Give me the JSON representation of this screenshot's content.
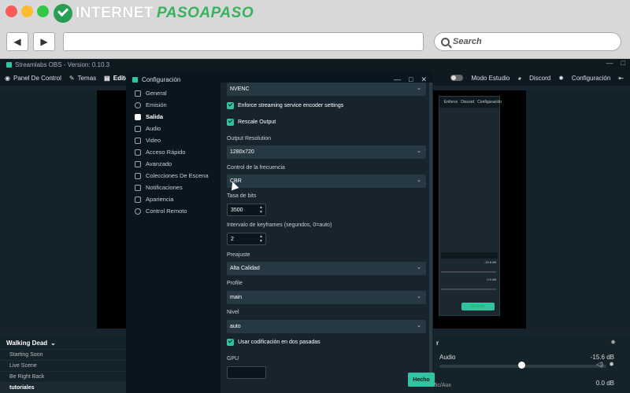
{
  "browser": {
    "brand_part1": "INTERNET",
    "brand_part2": "PASOAPASO",
    "search_placeholder": "Search",
    "back_icon": "◀",
    "forward_icon": "▶"
  },
  "app": {
    "title": "Streamlabs OBS - Version: 0.10.3",
    "nav": [
      "Panel De Control",
      "Temas",
      "Editor"
    ],
    "nav_right": [
      "Modo Estudio",
      "Discord",
      "Configuración"
    ]
  },
  "modal": {
    "title": "Configuración",
    "sidebar": [
      {
        "label": "General",
        "icon": "gear-icon"
      },
      {
        "label": "Emisión",
        "icon": "globe-icon"
      },
      {
        "label": "Salida",
        "icon": "output-icon"
      },
      {
        "label": "Audio",
        "icon": "speaker-icon"
      },
      {
        "label": "Video",
        "icon": "video-icon"
      },
      {
        "label": "Acceso Rápido",
        "icon": "shortcut-icon"
      },
      {
        "label": "Avanzado",
        "icon": "advanced-icon"
      },
      {
        "label": "Colecciones De Escena",
        "icon": "collections-icon"
      },
      {
        "label": "Notificaciones",
        "icon": "bell-icon"
      },
      {
        "label": "Apariencia",
        "icon": "appearance-icon"
      },
      {
        "label": "Control Remoto",
        "icon": "remote-icon"
      }
    ],
    "active_item": "Salida",
    "encoder_value": "NVENC",
    "enforce_label": "Enforce streaming service encoder settings",
    "rescale_label": "Rescale Output",
    "output_res_label": "Output Resolution",
    "output_res_value": "1280x720",
    "rate_control_label": "Control de la frecuencia",
    "rate_control_value": "CBR",
    "bitrate_label": "Tasa de bits",
    "bitrate_value": "3500",
    "keyframe_label": "Intervalo de keyframes (segundos, 0=auto)",
    "keyframe_value": "2",
    "preset_label": "Preajuste",
    "preset_value": "Alta Calidad",
    "profile_label": "Profile",
    "profile_value": "main",
    "level_label": "Nivel",
    "level_value": "auto",
    "twopass_label": "Usar codificación en dos pasadas",
    "gpu_label": "GPU",
    "done_label": "Hecho"
  },
  "scenes": {
    "collection": "Walking Dead",
    "items": [
      "Starting Soon",
      "Live Scene",
      "Be Right Back",
      "tutoriales"
    ],
    "selected": "tutoriales"
  },
  "mixer": {
    "header": "r",
    "source": "Audio",
    "db1": "-15.6 dB",
    "db2": "0.0 dB",
    "mic": "Mic/Aux"
  },
  "mini": {
    "nav": [
      "Enforce",
      "Discord",
      "Configuración"
    ],
    "db1": "-15.6 dB",
    "db2": "0.0 dB",
    "golive": "Go Live"
  },
  "colors": {
    "accent": "#31c3a2",
    "bg": "#17242d",
    "modal_bg": "#09161d"
  }
}
